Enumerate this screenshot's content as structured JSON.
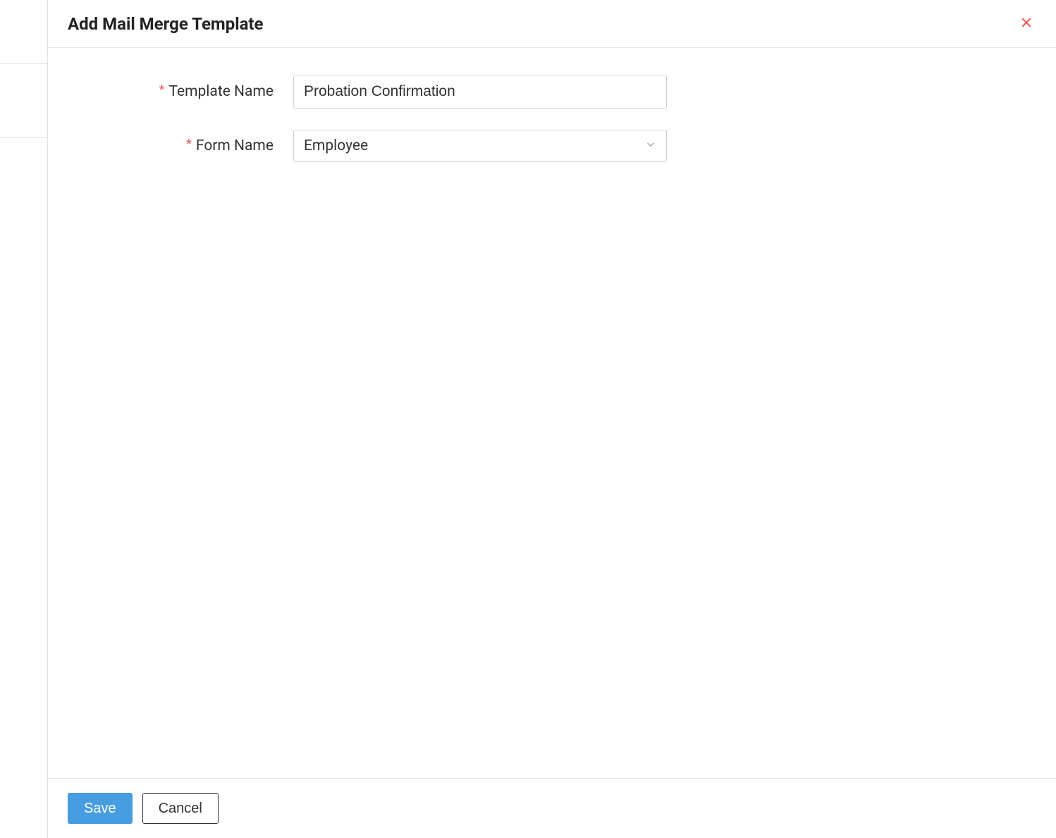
{
  "modal": {
    "title": "Add Mail Merge Template",
    "fields": {
      "template_name": {
        "label": "Template Name",
        "value": "Probation Confirmation"
      },
      "form_name": {
        "label": "Form Name",
        "selected": "Employee"
      }
    },
    "actions": {
      "save_label": "Save",
      "cancel_label": "Cancel"
    }
  }
}
